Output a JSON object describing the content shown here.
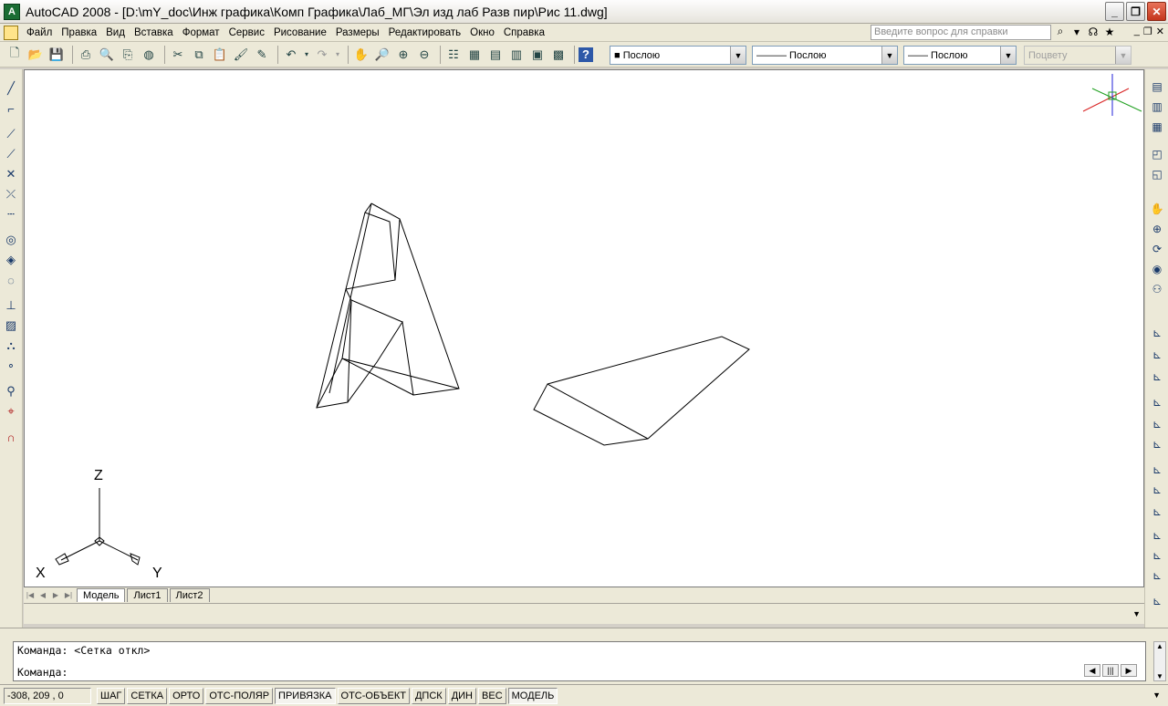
{
  "window": {
    "app_icon": "A",
    "title": "AutoCAD 2008 - [D:\\mY_doc\\Инж графика\\Комп Графика\\Лаб_МГ\\Эл изд лаб Разв пир\\Рис 11.dwg]",
    "minimize": "_",
    "restore": "❐",
    "close": "✕"
  },
  "menu": {
    "items": [
      "Файл",
      "Правка",
      "Вид",
      "Вставка",
      "Формат",
      "Сервис",
      "Рисование",
      "Размеры",
      "Редактировать",
      "Окно",
      "Справка"
    ],
    "help_placeholder": "Введите вопрос для справки"
  },
  "toolbar": {
    "color_value": "■ Послою",
    "linetype_value": "——— Послою",
    "lineweight_value": "—— Послою",
    "plotstyle_value": "Поцвету"
  },
  "layout_tabs": [
    "Модель",
    "Лист1",
    "Лист2"
  ],
  "ucs_labels": {
    "z": "Z",
    "x": "X",
    "y": "Y"
  },
  "command": {
    "history": "Команда:  <Сетка откл>",
    "prompt": "Команда:"
  },
  "status": {
    "coords": "-308, 209 , 0",
    "buttons": [
      "ШАГ",
      "СЕТКА",
      "ОРТО",
      "ОТС-ПОЛЯР",
      "ПРИВЯЗКА",
      "ОТС-ОБЪЕКТ",
      "ДПСК",
      "ДИН",
      "ВЕС",
      "МОДЕЛЬ"
    ],
    "active": [
      "ПРИВЯЗКА",
      "МОДЕЛЬ"
    ]
  }
}
